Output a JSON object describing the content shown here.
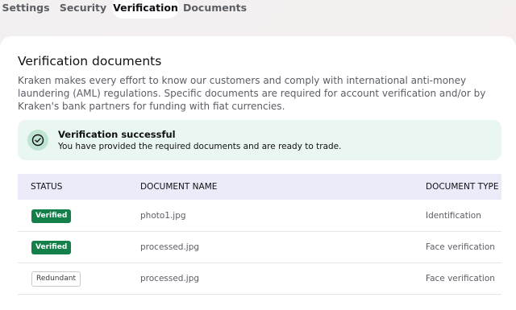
{
  "tabs": [
    {
      "label": "Settings",
      "active": false
    },
    {
      "label": "Security",
      "active": false
    },
    {
      "label": "Verification",
      "active": true
    },
    {
      "label": "Documents",
      "active": false
    }
  ],
  "section": {
    "title": "Verification documents",
    "description": "Kraken makes every effort to know our customers and comply with international anti-money laundering (AML) regulations. Specific documents are required for account verification and/or by Kraken's bank partners for funding with fiat currencies."
  },
  "alert": {
    "icon": "check-circle-icon",
    "title": "Verification successful",
    "text": "You have provided the required documents and are ready to trade.",
    "color": "#13804a"
  },
  "table": {
    "headers": {
      "status": "STATUS",
      "name": "DOCUMENT NAME",
      "type": "DOCUMENT TYPE"
    },
    "rows": [
      {
        "status": "Verified",
        "status_kind": "verified",
        "name": "photo1.jpg",
        "type": "Identification"
      },
      {
        "status": "Verified",
        "status_kind": "verified",
        "name": "processed.jpg",
        "type": "Face verification"
      },
      {
        "status": "Redundant",
        "status_kind": "redundant",
        "name": "processed.jpg",
        "type": "Face verification"
      }
    ]
  }
}
